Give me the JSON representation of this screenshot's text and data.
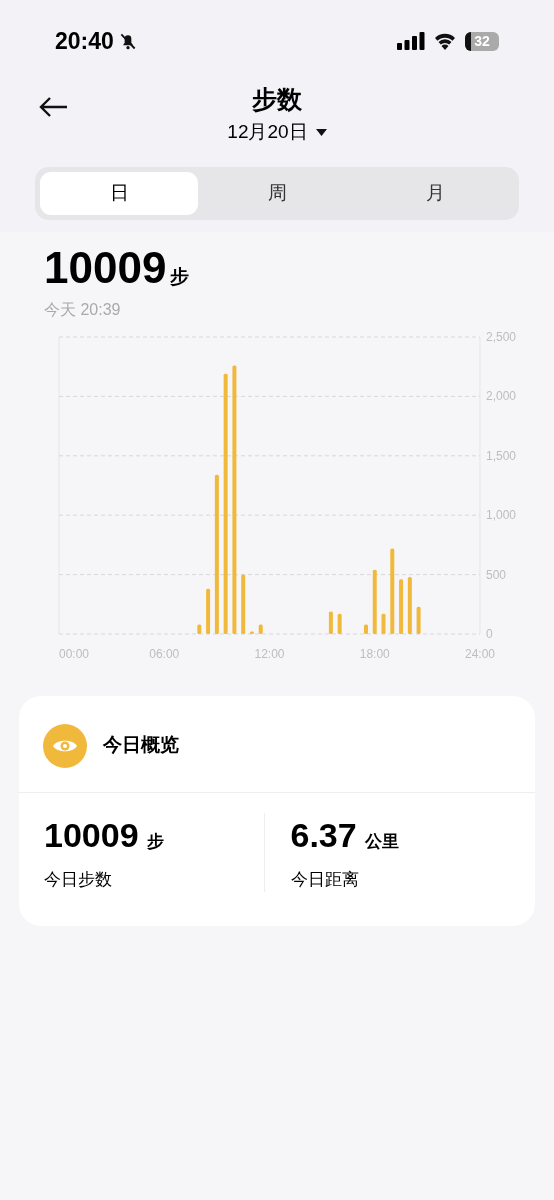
{
  "status_bar": {
    "time": "20:40",
    "battery": "32"
  },
  "header": {
    "title": "步数",
    "date": "12月20日"
  },
  "tabs": [
    {
      "label": "日",
      "selected": true
    },
    {
      "label": "周",
      "selected": false
    },
    {
      "label": "月",
      "selected": false
    }
  ],
  "summary": {
    "value": "10009",
    "unit": "步",
    "time": "今天 20:39"
  },
  "chart_data": {
    "type": "bar",
    "x": [
      8,
      8.5,
      9,
      9.5,
      10,
      10.5,
      11,
      11.5,
      15.5,
      16,
      17.5,
      18,
      18.5,
      19,
      19.5,
      20,
      20.5
    ],
    "grid": true,
    "series": [
      {
        "color": "#f0b93b",
        "values": [
          80,
          380,
          1340,
          2190,
          2260,
          500,
          20,
          80,
          190,
          170,
          80,
          540,
          170,
          720,
          460,
          480,
          230
        ]
      }
    ],
    "xlim": [
      0,
      24
    ],
    "ylim": [
      0,
      2500
    ],
    "xticks": [
      {
        "value": 0,
        "label": "00:00"
      },
      {
        "value": 6,
        "label": "06:00"
      },
      {
        "value": 12,
        "label": "12:00"
      },
      {
        "value": 18,
        "label": "18:00"
      },
      {
        "value": 24,
        "label": "24:00"
      }
    ],
    "yticks": [
      {
        "value": 0,
        "label": "0"
      },
      {
        "value": 500,
        "label": "500"
      },
      {
        "value": 1000,
        "label": "1,000"
      },
      {
        "value": 1500,
        "label": "1,500"
      },
      {
        "value": 2000,
        "label": "2,000"
      },
      {
        "value": 2500,
        "label": "2,500"
      }
    ]
  },
  "overview": {
    "title": "今日概览",
    "stats": [
      {
        "value": "10009",
        "unit": "步",
        "label": "今日步数"
      },
      {
        "value": "6.37",
        "unit": "公里",
        "label": "今日距离"
      }
    ]
  }
}
